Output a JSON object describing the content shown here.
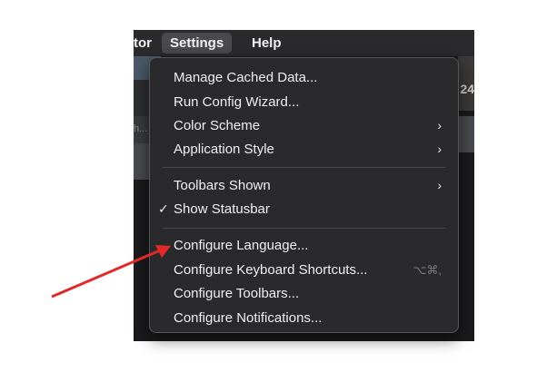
{
  "menubar": {
    "items": [
      {
        "label": "tor"
      },
      {
        "label": "Settings"
      },
      {
        "label": "Help"
      }
    ]
  },
  "background": {
    "right_fragment": ":24",
    "left_fragment": "h..."
  },
  "settings_menu": {
    "groups": [
      [
        {
          "label": "Manage Cached Data..."
        },
        {
          "label": "Run Config Wizard..."
        },
        {
          "label": "Color Scheme",
          "chevron": "›"
        },
        {
          "label": "Application Style",
          "chevron": "›"
        }
      ],
      [
        {
          "label": "Toolbars Shown",
          "chevron": "›"
        },
        {
          "label": "Show Statusbar",
          "check": "✓"
        }
      ],
      [
        {
          "label": "Configure Language..."
        },
        {
          "label": "Configure Keyboard Shortcuts...",
          "shortcut": "⌥⌘,"
        },
        {
          "label": "Configure Toolbars..."
        },
        {
          "label": "Configure Notifications..."
        }
      ]
    ]
  },
  "annotation": {
    "arrow_color": "#e02a2a",
    "points_to": "Configure Language..."
  }
}
